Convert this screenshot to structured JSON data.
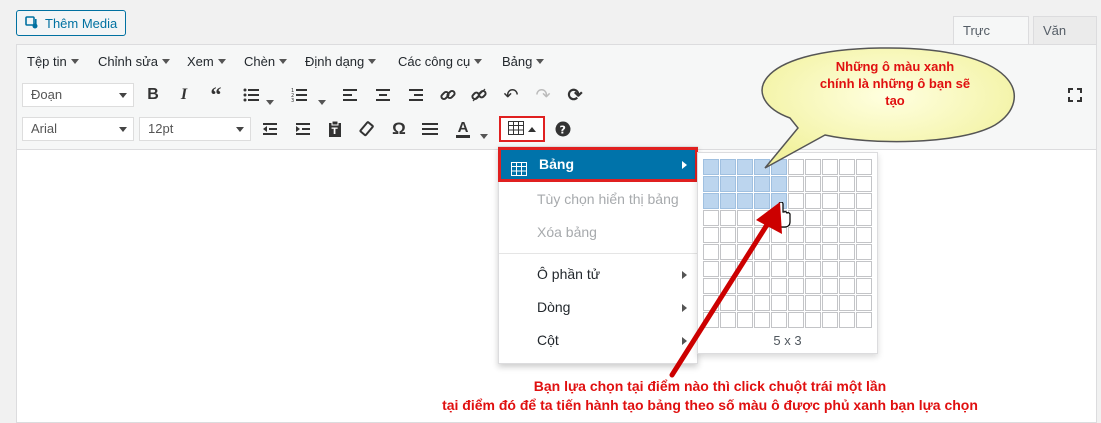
{
  "header": {
    "add_media_label": "Thêm Media"
  },
  "tabs": [
    {
      "label": "Trực quan"
    },
    {
      "label": "Văn bản"
    }
  ],
  "menubar": [
    "Tệp tin",
    "Chỉnh sửa",
    "Xem",
    "Chèn",
    "Định dạng",
    "Các công cụ",
    "Bảng"
  ],
  "toolbar": {
    "format_select": "Đoạn",
    "font_select": "Arial",
    "size_select": "12pt"
  },
  "table_menu": {
    "items": [
      {
        "label": "Bảng",
        "active": true,
        "submenu": true
      },
      {
        "label": "Tùy chọn hiển thị bảng",
        "disabled": true
      },
      {
        "label": "Xóa bảng",
        "disabled": true
      },
      {
        "label": "Ô phần tử",
        "submenu": true
      },
      {
        "label": "Dòng",
        "submenu": true
      },
      {
        "label": "Cột",
        "submenu": true
      }
    ]
  },
  "grid_picker": {
    "size_label": "5 x 3",
    "selected_cols": 5,
    "selected_rows": 3
  },
  "annotations": {
    "bubble": "Những ô màu xanh\nchính là những ô bạn sẽ\ntạo",
    "bottom_line1": "Bạn lựa chọn tại điểm nào thì click chuột trái một lần",
    "bottom_line2": "tại điểm đó để ta tiến hành tạo bảng theo số màu ô được phủ xanh bạn lựa chọn"
  },
  "colors": {
    "accent": "#0073aa",
    "highlight_red": "#e01010",
    "selected_cell": "#bcd5ee",
    "bubble_fill": "#ffffc0"
  }
}
